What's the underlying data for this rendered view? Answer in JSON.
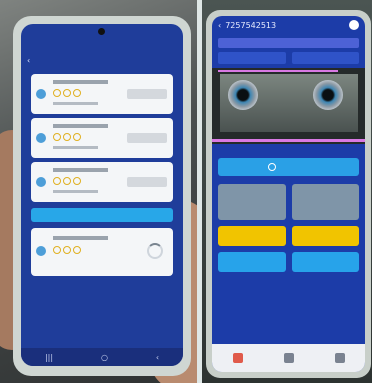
{
  "left": {
    "status_time": "",
    "title": "",
    "timer": "",
    "cards": [
      "",
      "",
      ""
    ],
    "add_button": "",
    "card4": ""
  },
  "right": {
    "device_id": "7257542513",
    "accent": "#f1c400"
  },
  "colors": {
    "screen_blue": "#1f3d9a",
    "bar_blue": "#28a7e8",
    "yellow": "#f1c400"
  }
}
